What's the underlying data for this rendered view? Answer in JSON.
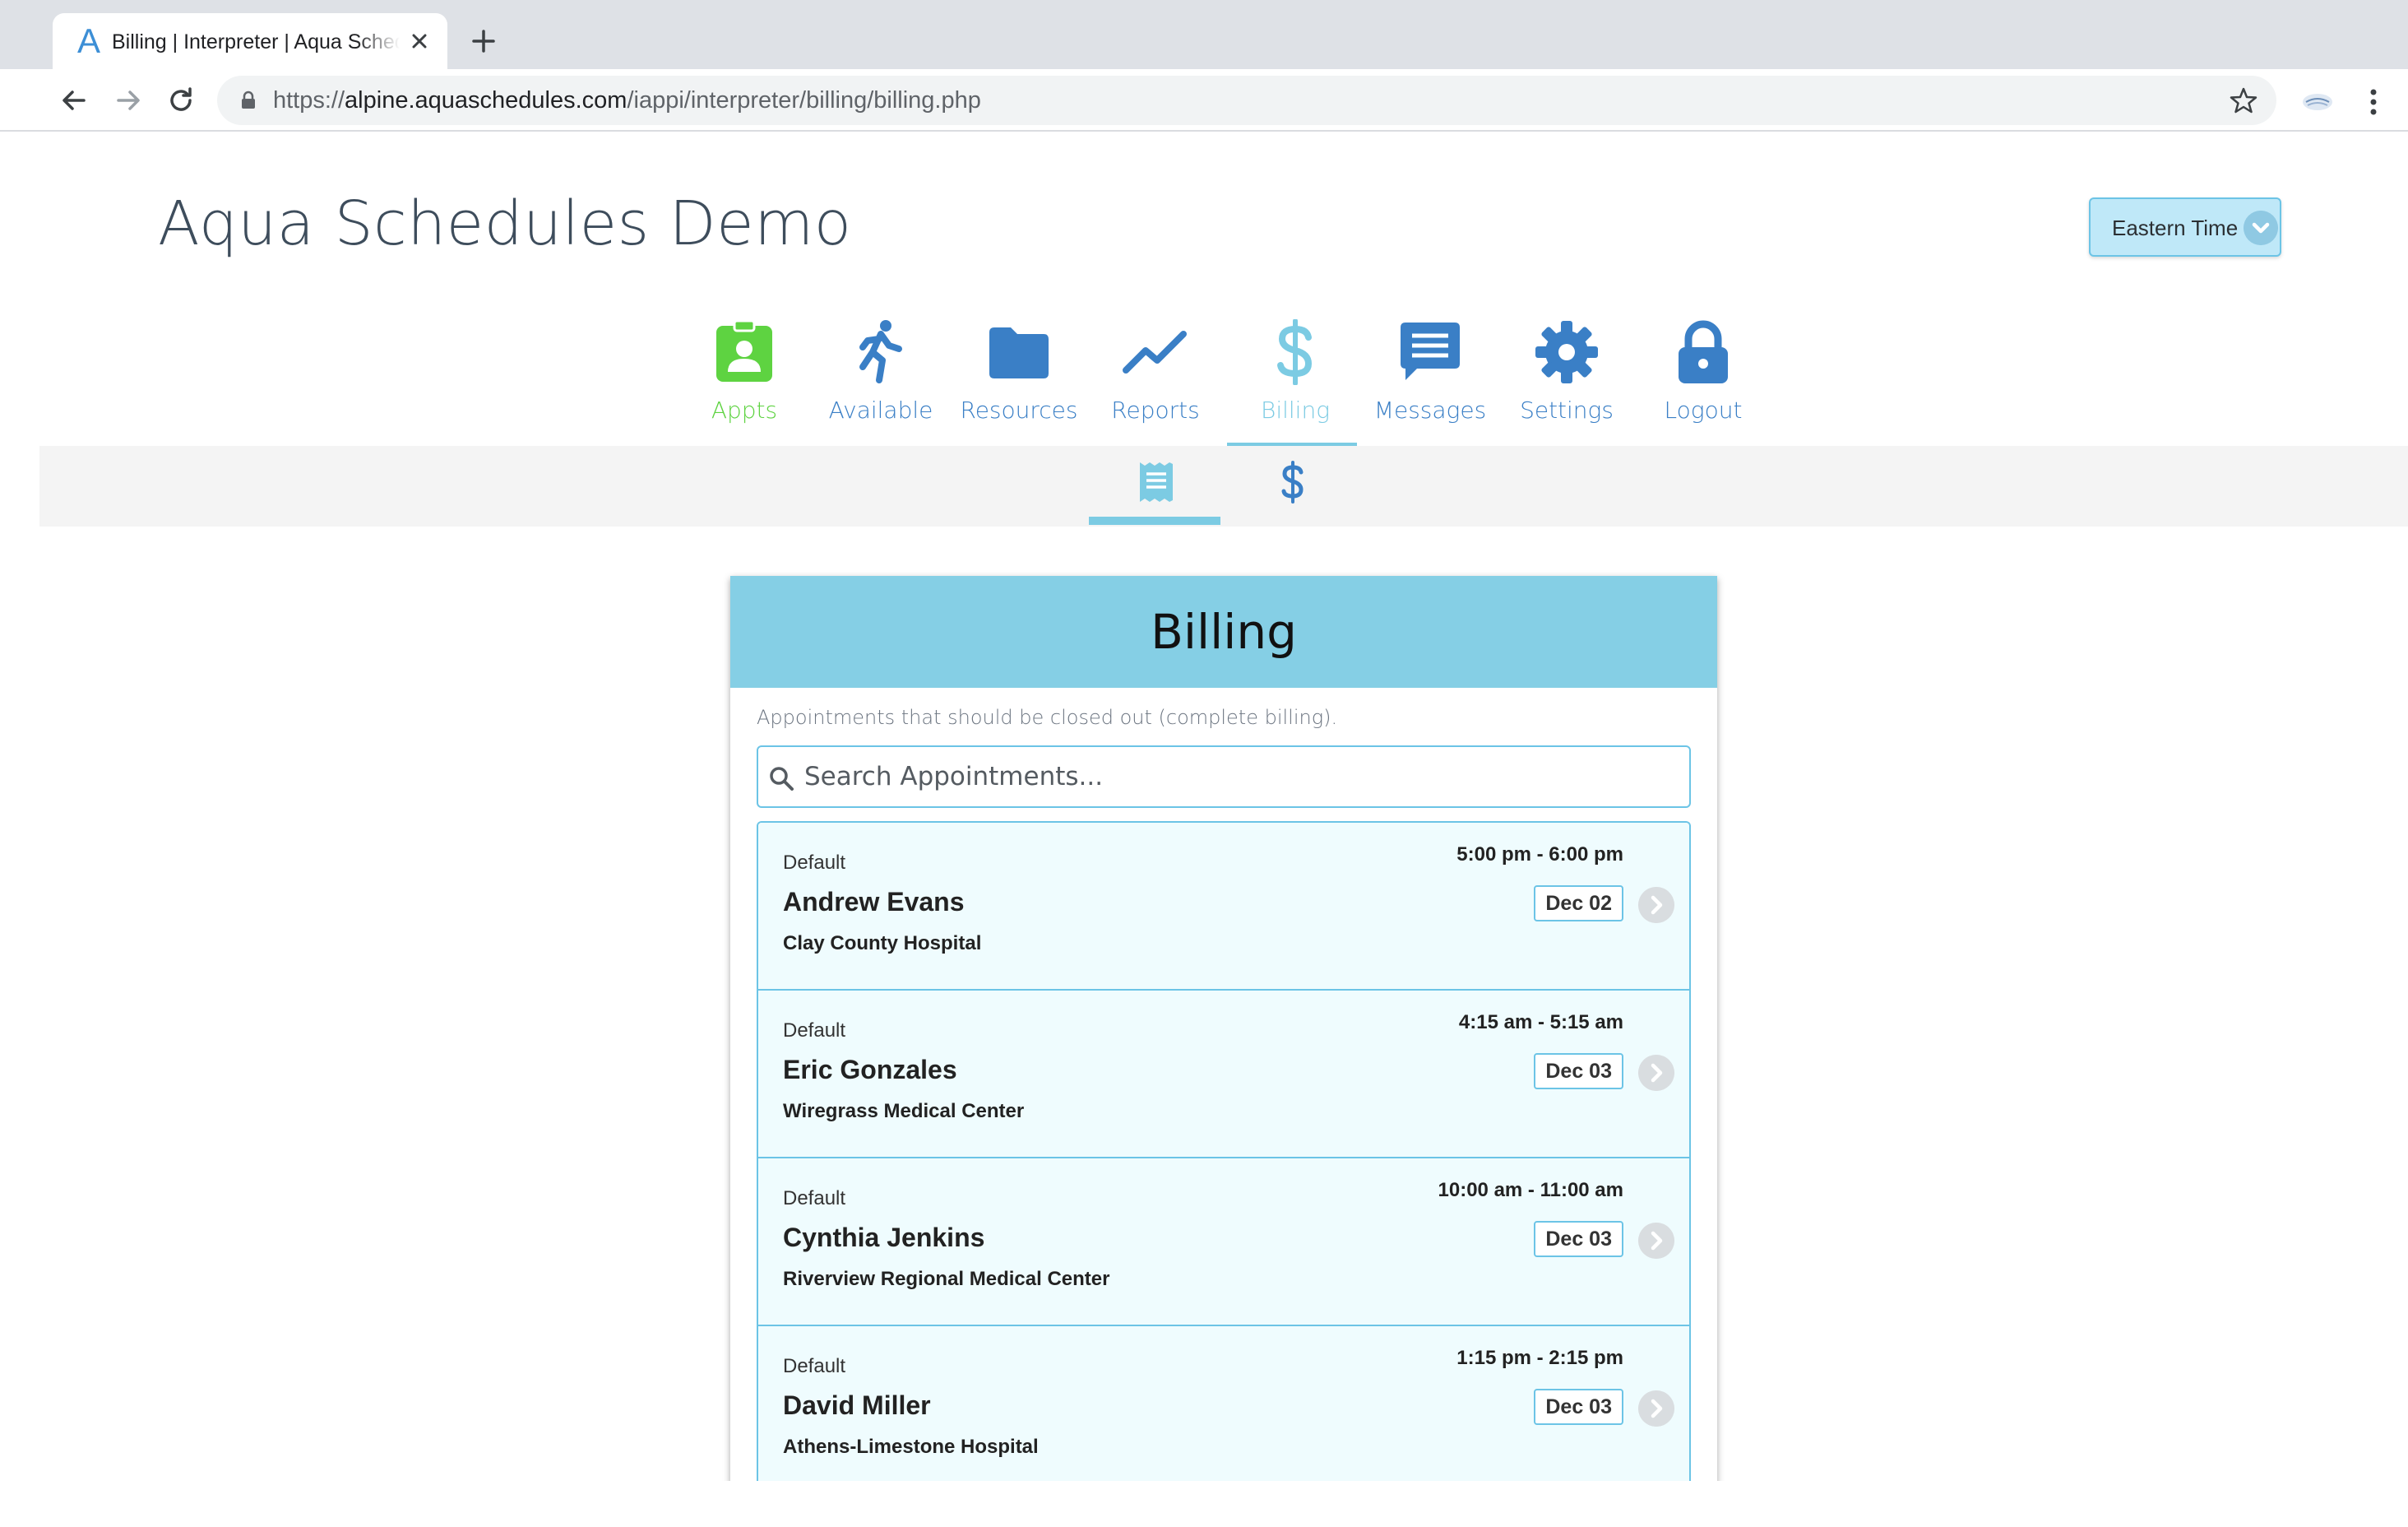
{
  "browser": {
    "tab_title": "Billing | Interpreter | Aqua Schedules",
    "favicon_letter": "A",
    "url_scheme": "https://",
    "url_host": "alpine.aquaschedules.com",
    "url_path": "/iappi/interpreter/billing/billing.php"
  },
  "header": {
    "site_title": "Aqua Schedules Demo",
    "timezone": "Eastern Time"
  },
  "nav": {
    "items": [
      {
        "label": "Appts",
        "icon": "id-badge-icon",
        "color": "#5ed341"
      },
      {
        "label": "Available",
        "icon": "running-person-icon",
        "color": "#3a7fc6"
      },
      {
        "label": "Resources",
        "icon": "folder-icon",
        "color": "#3a7fc6"
      },
      {
        "label": "Reports",
        "icon": "line-chart-icon",
        "color": "#3a7fc6"
      },
      {
        "label": "Billing",
        "icon": "dollar-icon",
        "color": "#7ccbe3",
        "active": true
      },
      {
        "label": "Messages",
        "icon": "message-icon",
        "color": "#3a7fc6"
      },
      {
        "label": "Settings",
        "icon": "gear-icon",
        "color": "#3a7fc6"
      },
      {
        "label": "Logout",
        "icon": "lock-icon",
        "color": "#3a7fc6"
      }
    ],
    "sub_items": [
      {
        "icon": "receipt-icon",
        "active": true
      },
      {
        "icon": "dollar-icon",
        "active": false
      }
    ]
  },
  "billing": {
    "title": "Billing",
    "description": "Appointments that should be closed out (complete billing).",
    "search_placeholder": "Search Appointments...",
    "appointments": [
      {
        "type": "Default",
        "name": "Andrew Evans",
        "facility": "Clay County Hospital",
        "time": "5:00 pm - 6:00 pm",
        "date": "Dec 02"
      },
      {
        "type": "Default",
        "name": "Eric Gonzales",
        "facility": "Wiregrass Medical Center",
        "time": "4:15 am - 5:15 am",
        "date": "Dec 03"
      },
      {
        "type": "Default",
        "name": "Cynthia Jenkins",
        "facility": "Riverview Regional Medical Center",
        "time": "10:00 am - 11:00 am",
        "date": "Dec 03"
      },
      {
        "type": "Default",
        "name": "David Miller",
        "facility": "Athens-Limestone Hospital",
        "time": "1:15 pm - 2:15 pm",
        "date": "Dec 03"
      }
    ]
  },
  "colors": {
    "accent": "#85cfe5",
    "nav_blue": "#3a7fc6",
    "nav_green": "#5ed341",
    "border_blue": "#6cc4e6",
    "row_bg": "#effcfe"
  }
}
